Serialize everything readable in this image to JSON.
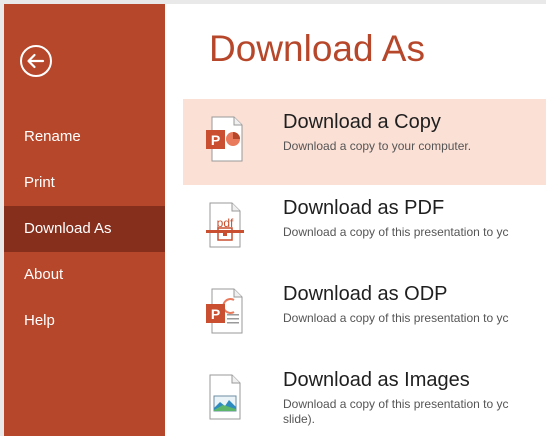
{
  "sidebar": {
    "back_icon": "back-arrow-circle-icon",
    "items": [
      {
        "label": "Rename"
      },
      {
        "label": "Print"
      },
      {
        "label": "Download As",
        "active": true
      },
      {
        "label": "About"
      },
      {
        "label": "Help"
      }
    ]
  },
  "main": {
    "title": "Download As",
    "options": [
      {
        "title": "Download a Copy",
        "description": "Download a copy to your computer.",
        "icon": "powerpoint-file-icon",
        "selected": true
      },
      {
        "title": "Download as PDF",
        "description": "Download a copy of this presentation to yc",
        "icon": "pdf-file-icon"
      },
      {
        "title": "Download as ODP",
        "description": "Download a copy of this presentation to yc",
        "icon": "odp-file-icon"
      },
      {
        "title": "Download as Images",
        "description": "Download a copy of this presentation to yc",
        "description_line2": "slide).",
        "icon": "image-file-icon"
      }
    ]
  },
  "colors": {
    "accent": "#b7472a",
    "sidebar_active": "#872f1d",
    "selected_bg": "#fbe0d6"
  }
}
